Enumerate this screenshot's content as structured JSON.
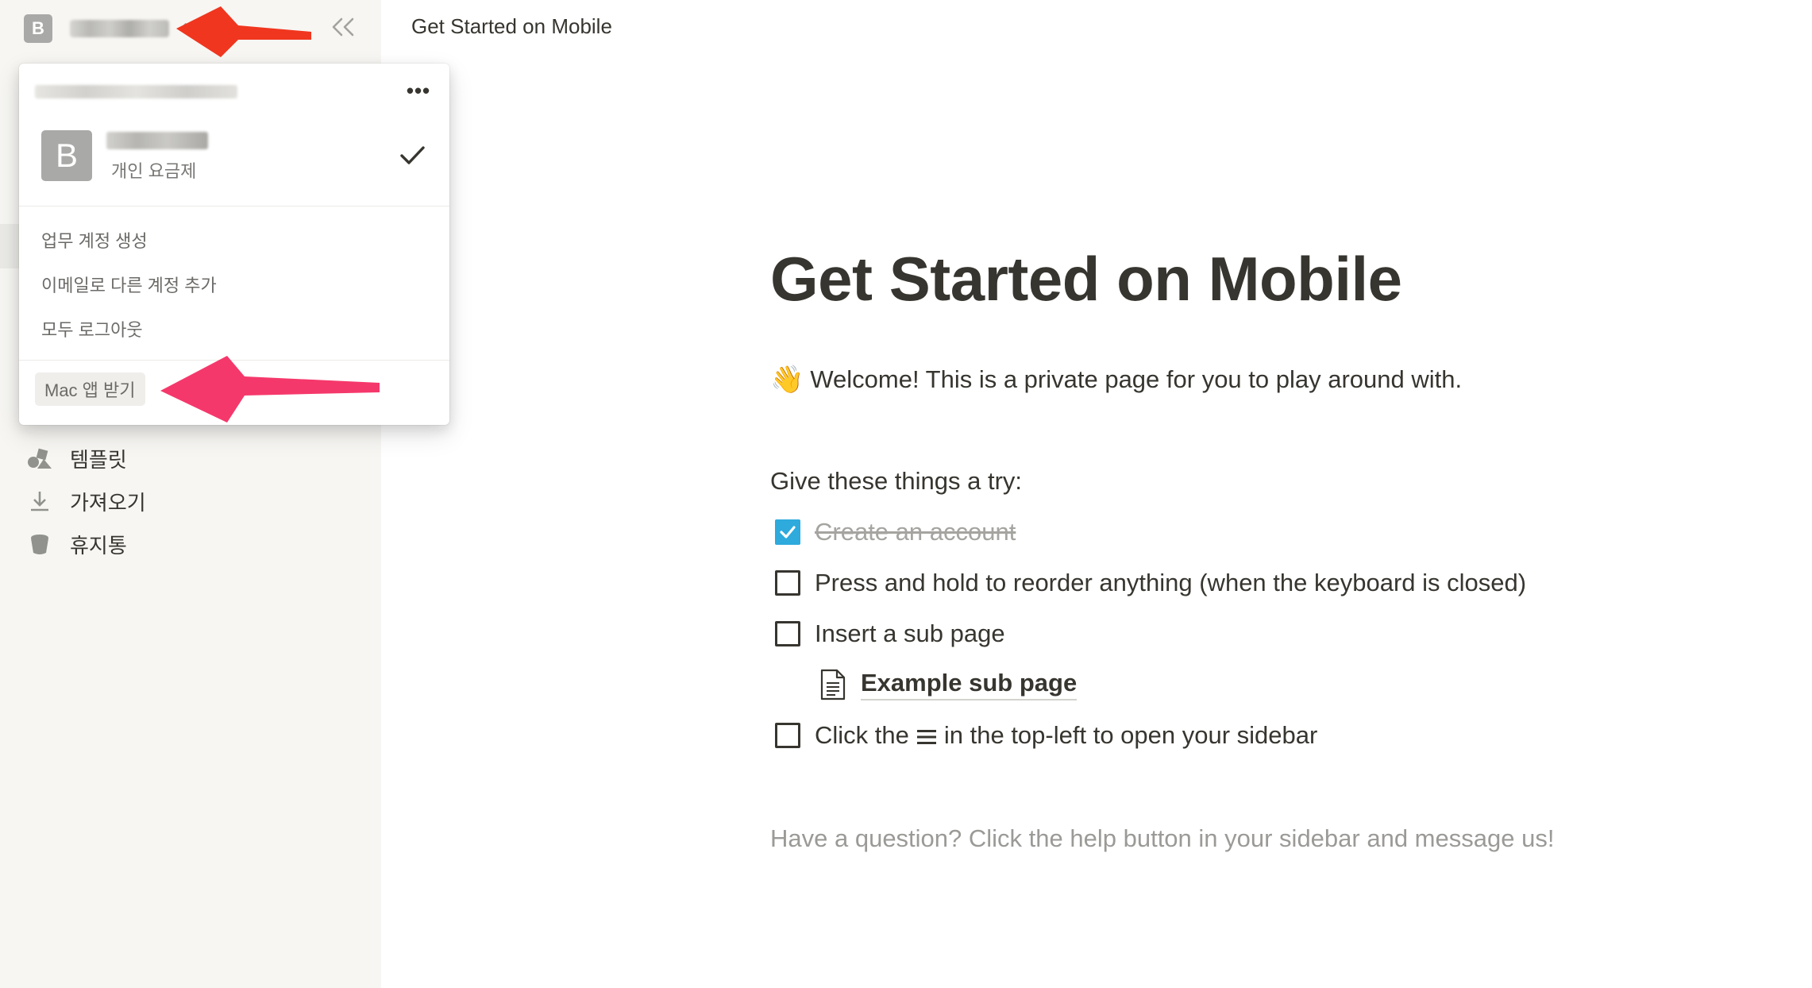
{
  "sidebar": {
    "workspace_badge": "B",
    "nav": [
      {
        "label": "템플릿",
        "icon": "templates-icon"
      },
      {
        "label": "가져오기",
        "icon": "import-icon"
      },
      {
        "label": "휴지통",
        "icon": "trash-icon"
      }
    ]
  },
  "popup": {
    "account": {
      "badge": "B",
      "plan": "개인 요금제"
    },
    "menu": [
      "업무 계정 생성",
      "이메일로 다른 계정 추가",
      "모두 로그아웃"
    ],
    "get_app": "Mac 앱 받기"
  },
  "topbar": {
    "title": "Get Started on Mobile"
  },
  "page": {
    "title": "Get Started on Mobile",
    "welcome_emoji": "👋",
    "welcome": "Welcome! This is a private page for you to play around with.",
    "try_heading": "Give these things a try:",
    "todos": [
      {
        "text": "Create an account",
        "checked": true
      },
      {
        "text": "Press and hold to reorder anything (when the keyboard is closed)",
        "checked": false
      },
      {
        "text": "Insert a sub page",
        "checked": false
      },
      {
        "text_before": "Click the",
        "text_after": "in the top-left to open your sidebar",
        "checked": false
      }
    ],
    "subpage_link": "Example sub page",
    "help": "Have a question? Click the help button in your sidebar and message us!"
  },
  "colors": {
    "checkbox_checked": "#2eaadc",
    "arrow_top": "#f0361f",
    "arrow_bottom": "#f5386b",
    "sidebar_bg": "#f7f6f3"
  }
}
